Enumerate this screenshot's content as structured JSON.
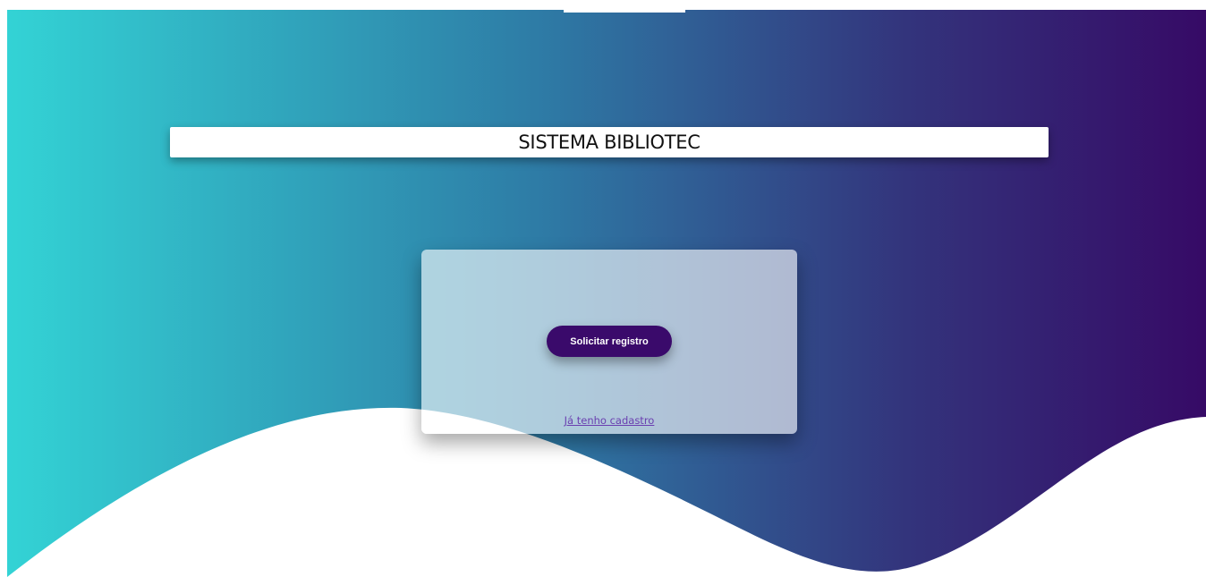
{
  "header": {
    "title": "SISTEMA BIBLIOTEC"
  },
  "card": {
    "register_button_label": "Solicitar registro",
    "login_link_text": "Já tenho cadastro"
  },
  "colors": {
    "gradient_start": "#33d3d5",
    "gradient_end": "#360a66",
    "button": "#3a0a6b",
    "link": "#6a3fb0"
  }
}
